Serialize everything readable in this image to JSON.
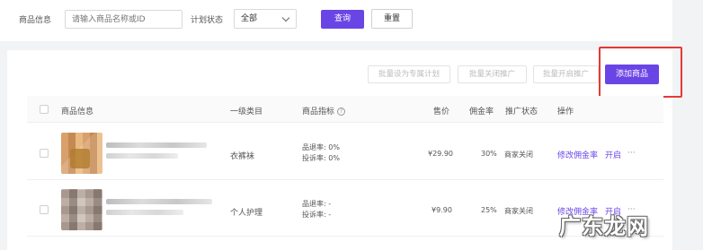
{
  "filters": {
    "product_info_label": "商品信息",
    "product_info_placeholder": "请输入商品名称或ID",
    "plan_status_label": "计划状态",
    "plan_status_value": "全部",
    "query_label": "查询",
    "reset_label": "重置"
  },
  "toolbar": {
    "batch_exclusive_plan": "批量设为专属计划",
    "batch_close_promo": "批量关闭推广",
    "batch_open_promo": "批量开启推广",
    "add_product": "添加商品"
  },
  "table": {
    "headers": {
      "product_info": "商品信息",
      "category": "一级类目",
      "metrics": "商品指标",
      "price": "售价",
      "commission": "佣金率",
      "promo_status": "推广状态",
      "actions": "操作"
    },
    "rows": [
      {
        "category": "衣裤袜",
        "refund_rate": "品退率: 0%",
        "complaint_rate": "投诉率: 0%",
        "price": "¥29.90",
        "commission": "30%",
        "status": "商家关闭",
        "edit_label": "修改佣金率",
        "toggle_label": "开启",
        "more_label": "···"
      },
      {
        "category": "个人护理",
        "refund_rate": "品退率: -",
        "complaint_rate": "投诉率: -",
        "price": "¥9.90",
        "commission": "25%",
        "status": "商家关闭",
        "edit_label": "修改佣金率",
        "toggle_label": "开启",
        "more_label": "···"
      }
    ]
  },
  "watermark": "广东龙网",
  "colors": {
    "accent": "#6a45e6",
    "highlight_box": "#e53935"
  }
}
